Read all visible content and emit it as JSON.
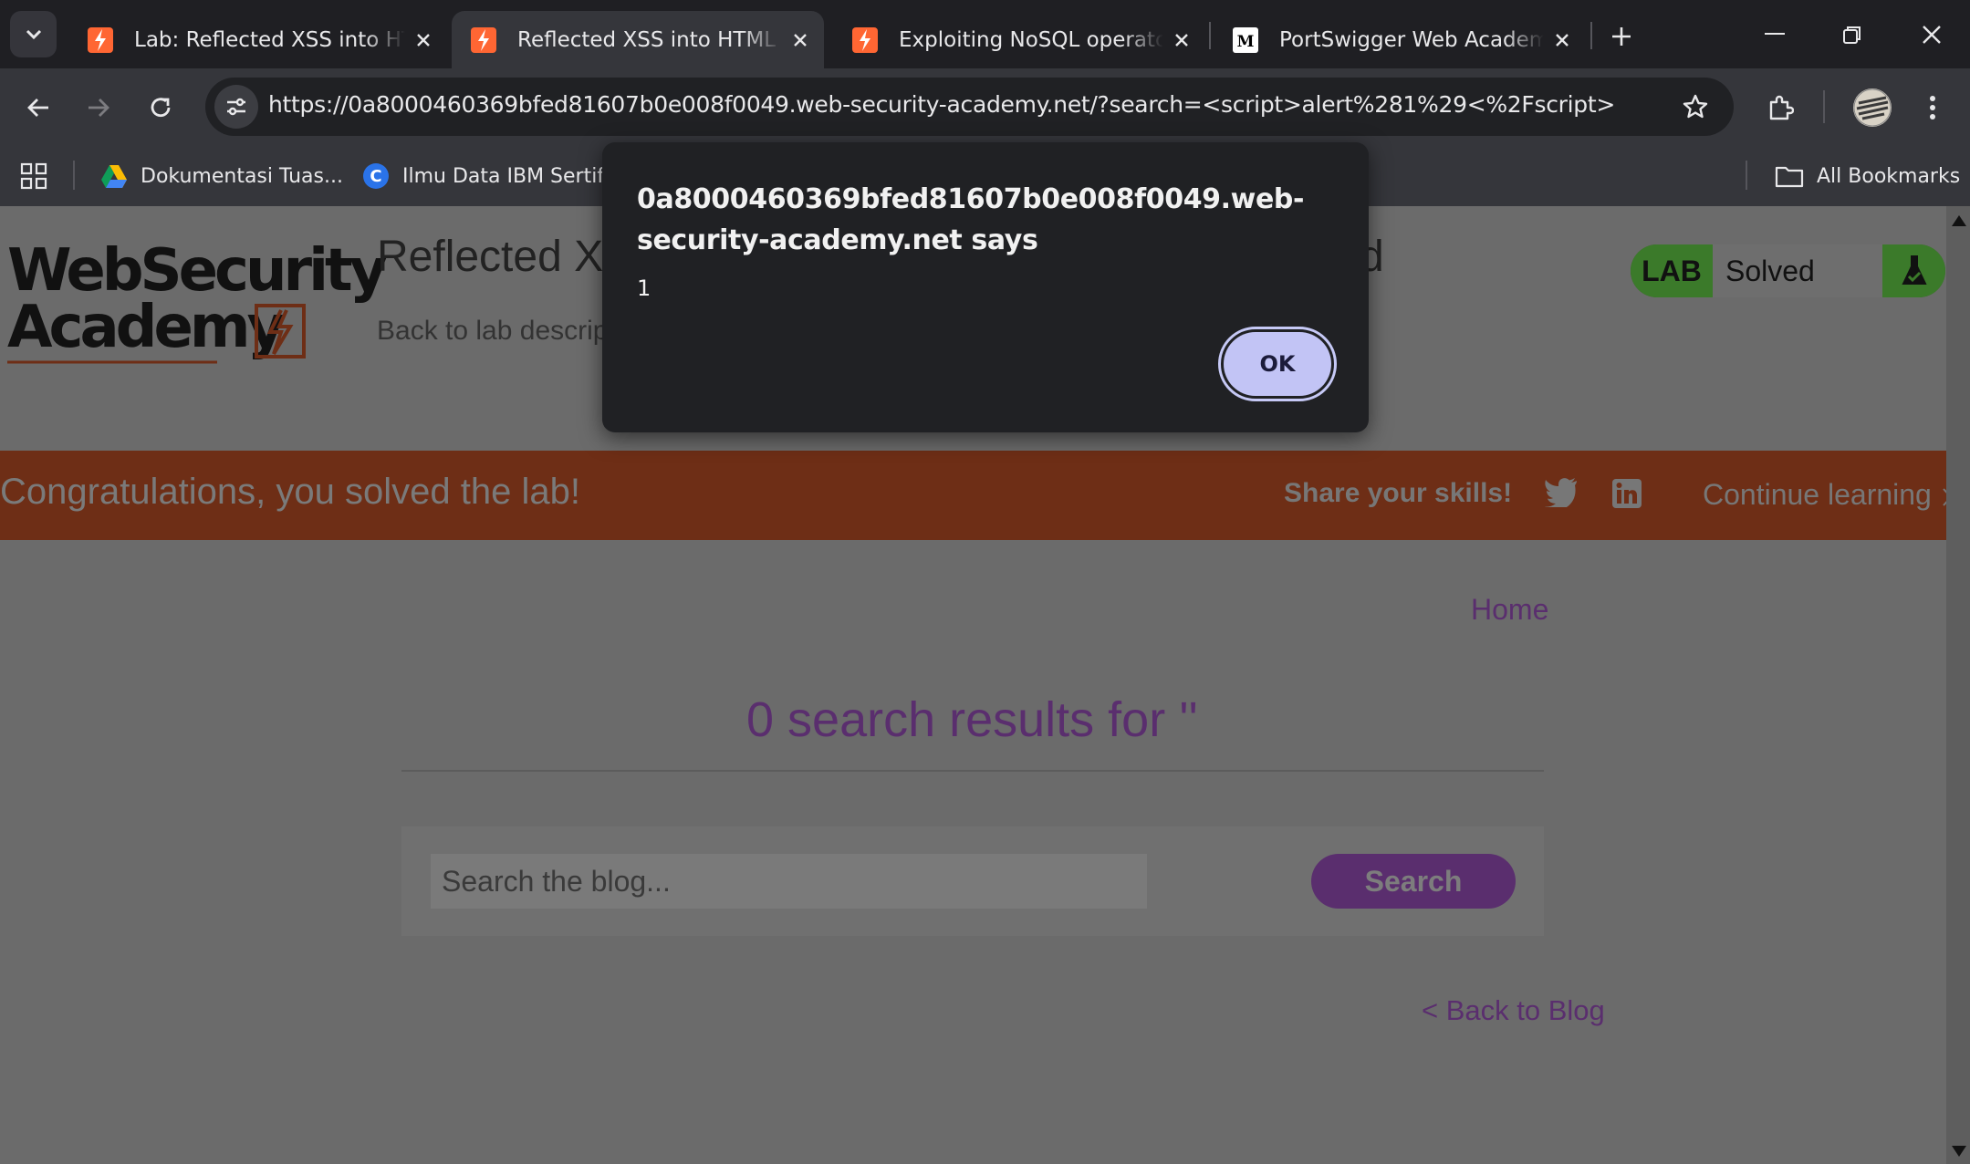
{
  "tabs": [
    {
      "title": "Lab: Reflected XSS into HTML context with nothing encoded",
      "favicon": "portswigger-icon",
      "active": false
    },
    {
      "title": "Reflected XSS into HTML context with nothing encoded",
      "favicon": "portswigger-icon",
      "active": true
    },
    {
      "title": "Exploiting NoSQL operator injection",
      "favicon": "portswigger-icon",
      "active": false
    },
    {
      "title": "PortSwigger Web Academy: Lab",
      "favicon": "medium-icon",
      "active": false
    }
  ],
  "address_bar": {
    "url": "https://0a8000460369bfed81607b0e008f0049.web-security-academy.net/?search=<script>alert%281%29<%2Fscript>"
  },
  "bookmarks": {
    "items": [
      {
        "label": "Dokumentasi Tuas...",
        "icon": "google-drive-icon"
      },
      {
        "label": "Ilmu Data IBM Sertif...",
        "icon": "coursera-icon"
      }
    ],
    "all_bookmarks_label": "All Bookmarks"
  },
  "page": {
    "logo_line1": "WebSecurity",
    "logo_line2": "Academy",
    "lab_title_visible": "Reflected XS",
    "lab_title_end": "d",
    "back_to_desc": "Back to lab descrip",
    "lab_badge": {
      "lab": "LAB",
      "status": "Solved"
    },
    "banner": {
      "message": "Congratulations, you solved the lab!",
      "share": "Share your skills!",
      "continue": "Continue learning"
    },
    "home_link": "Home",
    "results_heading": "0 search results for ''",
    "search": {
      "placeholder": "Search the blog...",
      "button": "Search"
    },
    "back_to_blog": "< Back to Blog"
  },
  "dialog": {
    "origin": "0a8000460369bfed81607b0e008f0049.web-security-academy.net says",
    "message": "1",
    "ok_label": "OK"
  },
  "colors": {
    "accent_orange": "#ff6633",
    "dialog_bg": "#202124",
    "ok_button": "#c2c4f5",
    "banner_dim": "#6e2e16",
    "link_purple_dim": "#5a2e6e"
  }
}
